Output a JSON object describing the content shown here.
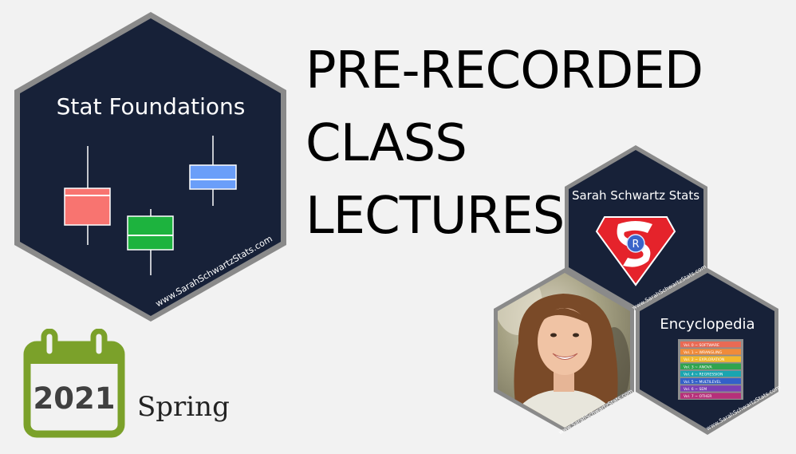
{
  "headline": {
    "line1": "PRE-RECORDED",
    "line2": "CLASS",
    "line3": "LECTURES"
  },
  "stat_hex": {
    "title": "Stat Foundations",
    "url": "www.SarahSchwartzStats.com",
    "box_colors": [
      "#f87470",
      "#1db33e",
      "#6a9ef9"
    ]
  },
  "stats_hex": {
    "title": "Sarah Schwartz Stats",
    "logo_letter": "R",
    "url": "www.SarahSchwartzStats.com"
  },
  "photo_hex": {
    "url": "www.SarahSchwartzStats.com"
  },
  "ency_hex": {
    "title": "Encyclopedia",
    "url": "www.SarahSchwartzStats.com",
    "volumes": [
      {
        "label": "Vol. 0 ~ SOFTWARE",
        "color": "#e96a54"
      },
      {
        "label": "Vol. 1 ~ WRANGLING",
        "color": "#f08b3a"
      },
      {
        "label": "Vol. 2 ~ EXPLORATION",
        "color": "#f3b82c"
      },
      {
        "label": "Vol. 3 ~ ANOVA",
        "color": "#2fa44f"
      },
      {
        "label": "Vol. 4 ~ REGRESSION",
        "color": "#1aa5b0"
      },
      {
        "label": "Vol. 5 ~ MULTILEVEL",
        "color": "#3361c9"
      },
      {
        "label": "Vol. 6 ~ SEM",
        "color": "#7b3fb5"
      },
      {
        "label": "Vol. 7 ~ OTHER",
        "color": "#b6307a"
      }
    ]
  },
  "calendar": {
    "year": "2021",
    "accent": "#7ba12a"
  },
  "season": "Spring",
  "colors": {
    "hex_fill": "#172138",
    "hex_border": "#8a8a8a"
  }
}
